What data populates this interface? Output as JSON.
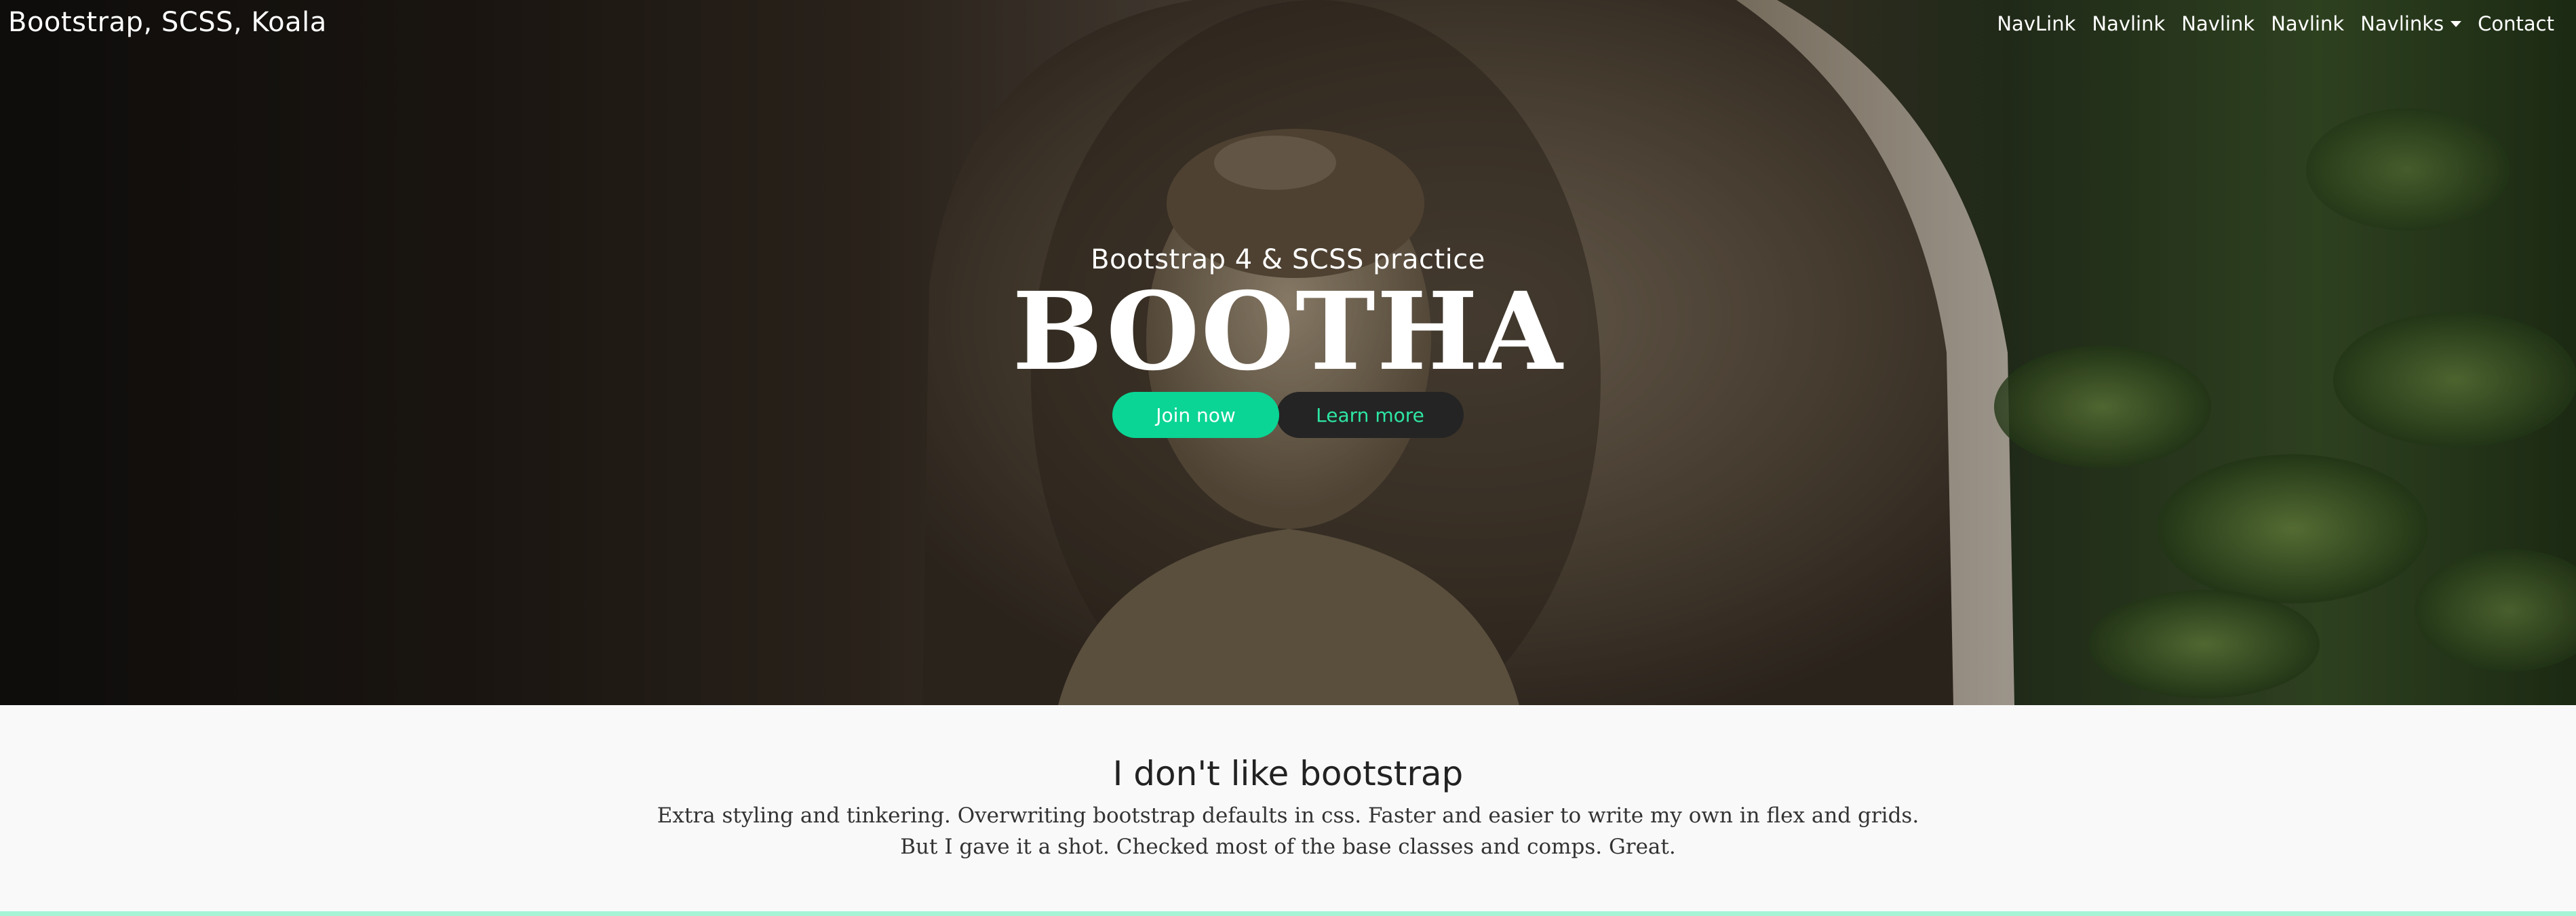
{
  "navbar": {
    "brand": "Bootstrap, SCSS, Koala",
    "links": [
      {
        "label": "NavLink"
      },
      {
        "label": "Navlink"
      },
      {
        "label": "Navlink"
      },
      {
        "label": "Navlink"
      },
      {
        "label": "Navlinks"
      },
      {
        "label": "Contact"
      }
    ]
  },
  "hero": {
    "subtitle": "Bootstrap 4 & SCSS practice",
    "title": "BOOTHA",
    "join_label": "Join now",
    "learn_label": "Learn more"
  },
  "section": {
    "title": "I don't like bootstrap",
    "line1": "Extra styling and tinkering. Overwriting bootstrap defaults in css. Faster and easier to write my own in flex and grids.",
    "line2": "But I gave it a shot. Checked most of the base classes and comps. Great."
  },
  "colors": {
    "accent": "#0ad594",
    "accent_text": "#2ee6a4",
    "dark_button": "#242424",
    "section_bg": "#f9f9f9",
    "bottom_border": "#a6f3d6"
  },
  "icons": {
    "dropdown": "caret-down-icon"
  }
}
